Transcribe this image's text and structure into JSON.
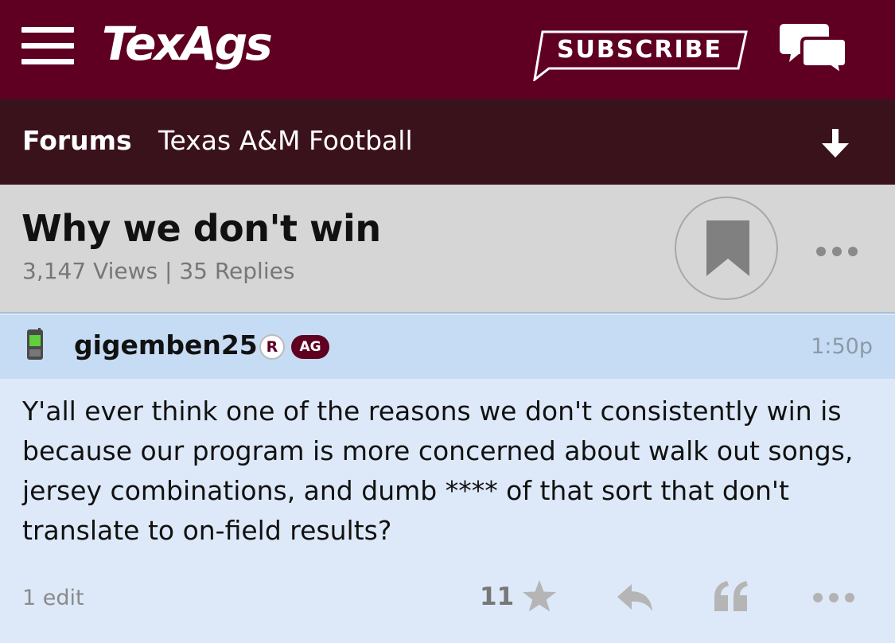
{
  "header": {
    "logo": "TexAgs",
    "subscribe_label": "SUBSCRIBE"
  },
  "subnav": {
    "forums_label": "Forums",
    "board_label": "Texas A&M Football"
  },
  "thread": {
    "title": "Why we don't win",
    "stats": "3,147 Views | 35 Replies"
  },
  "post": {
    "username": "gigemben25",
    "badge_r": "R",
    "badge_ag": "AG",
    "time": "1:50p",
    "body": "Y'all ever think one of the reasons we don't consistently win is because our program is more concerned about walk out songs, jersey combinations, and dumb **** of that sort that don't translate to on-field results?",
    "edit_label": "1 edit",
    "star_count": "11"
  },
  "icons": {
    "menu": "hamburger-menu-icon",
    "chat": "chat-bubbles-icon",
    "jump": "arrow-down-icon",
    "bookmark": "bookmark-icon",
    "device": "cell-phone-icon",
    "star": "star-icon",
    "reply": "reply-arrow-icon",
    "quote": "quote-icon",
    "more": "ellipsis-icon"
  },
  "colors": {
    "brand_maroon": "#5f0022",
    "subnav_bg": "#3a121c",
    "thread_header_bg": "#d6d6d6",
    "post_header_bg": "#c6dcf4",
    "post_body_bg": "#dde9f8"
  }
}
